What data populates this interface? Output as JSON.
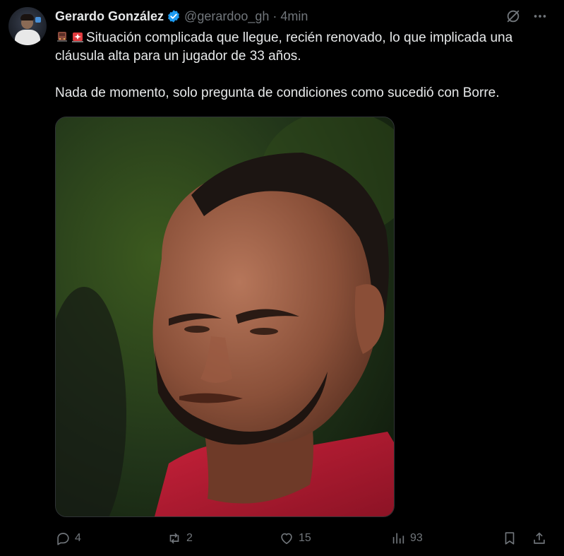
{
  "tweet": {
    "author_name": "Gerardo González",
    "handle": "@gerardoo_gh",
    "separator": "·",
    "time": "4min",
    "line1": "Situación complicada que llegue, recién renovado, lo que implicada una cláusula alta para un jugador de 33 años.",
    "line2": "Nada de momento, solo pregunta de condiciones como sucedió con Borre."
  },
  "actions": {
    "replies": "4",
    "reposts": "2",
    "likes": "15",
    "views": "93"
  },
  "colors": {
    "background": "#000000",
    "text": "#e7e9ea",
    "muted": "#71767b",
    "verified": "#1d9bf0"
  },
  "icons": [
    "avatar",
    "verified-badge-icon",
    "grok-icon",
    "more-icon",
    "train-emoji-icon",
    "siren-emoji-icon",
    "reply-icon",
    "repost-icon",
    "like-icon",
    "views-icon",
    "bookmark-icon",
    "share-icon"
  ]
}
